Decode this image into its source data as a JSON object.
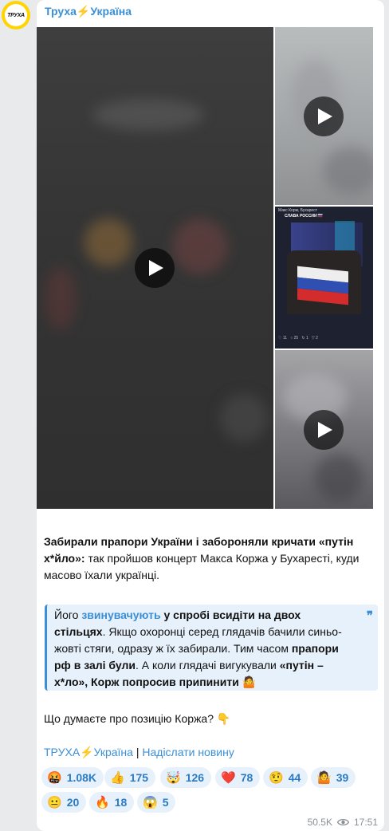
{
  "channel": {
    "logo_text": "ТРУХА",
    "name": "Труха⚡Україна"
  },
  "post": {
    "headline": "Забирали прапори України і забороняли кричати «путін х*йло»:",
    "lead": " так пройшов концерт Макса Коржа у Бухаресті, куди масово їхали українці.",
    "quote": {
      "p1": "Його ",
      "link": "звинувачують",
      "p2": " у спробі всидіти на двох стільцях",
      "p3": ". Якщо охоронці серед глядачів бачили синьо-жовті стяги, одразу ж їх забирали. Тим часом ",
      "p4": "прапори рф в залі були",
      "p5": ". А коли глядачі вигукували ",
      "p6": "«путін – х*ло», Корж попросив припинити",
      "emoji": "🤷"
    },
    "question": "Що думаєте про позицію Коржа? 👇",
    "footer_link1": "ТРУХА⚡Україна",
    "footer_sep": " | ",
    "footer_link2": "Надіслати новину"
  },
  "media": {
    "thumb_caption": "Макс Корж, Бухарест",
    "thumb_title": "СЛАВА РОССИИ 🇷🇺"
  },
  "reactions": [
    {
      "emoji": "🤬",
      "count": "1.08K"
    },
    {
      "emoji": "👍",
      "count": "175"
    },
    {
      "emoji": "🤯",
      "count": "126"
    },
    {
      "emoji": "❤️",
      "count": "78"
    },
    {
      "emoji": "🤨",
      "count": "44"
    },
    {
      "emoji": "🤷",
      "count": "39"
    },
    {
      "emoji": "😐",
      "count": "20"
    },
    {
      "emoji": "🔥",
      "count": "18"
    },
    {
      "emoji": "😱",
      "count": "5"
    }
  ],
  "meta": {
    "views": "50.5K",
    "time": "17:51"
  },
  "colors": {
    "accent": "#3a8fd6",
    "quote_bg": "#e7f1fb",
    "avatar_ring": "#ffd400"
  }
}
